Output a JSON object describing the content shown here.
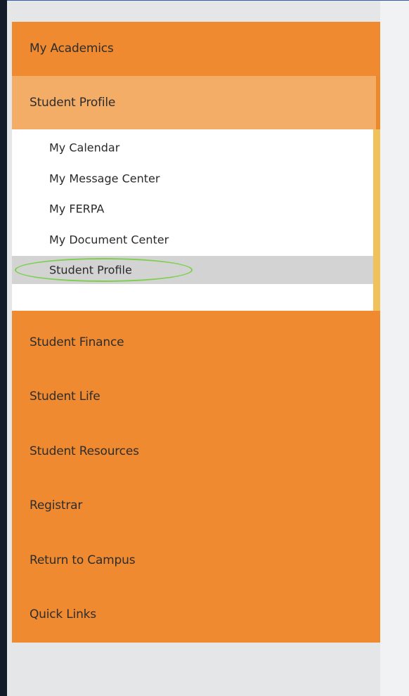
{
  "sidebar": {
    "items": [
      {
        "label": "My Academics"
      },
      {
        "label": "Student Profile"
      },
      {
        "label": "Student Finance"
      },
      {
        "label": "Student Life"
      },
      {
        "label": "Student Resources"
      },
      {
        "label": "Registrar"
      },
      {
        "label": "Return to Campus"
      },
      {
        "label": "Quick Links"
      }
    ],
    "active_item": "Student Profile",
    "submenu": {
      "items": [
        {
          "label": "My Calendar"
        },
        {
          "label": "My Message Center"
        },
        {
          "label": "My FERPA"
        },
        {
          "label": "My Document Center"
        },
        {
          "label": "Student Profile"
        }
      ],
      "selected_item": "Student Profile"
    }
  },
  "colors": {
    "menu_orange": "#f08a30",
    "active_item_bg": "#f3ad67",
    "submenu_bg": "#ffffff",
    "selected_subitem_bg": "#d3d3d3",
    "submenu_scroll_edge": "#f1c25b",
    "highlight_annotation": "#7ccf4a",
    "page_background": "#e5e6e7",
    "left_rail": "#131a2a"
  }
}
